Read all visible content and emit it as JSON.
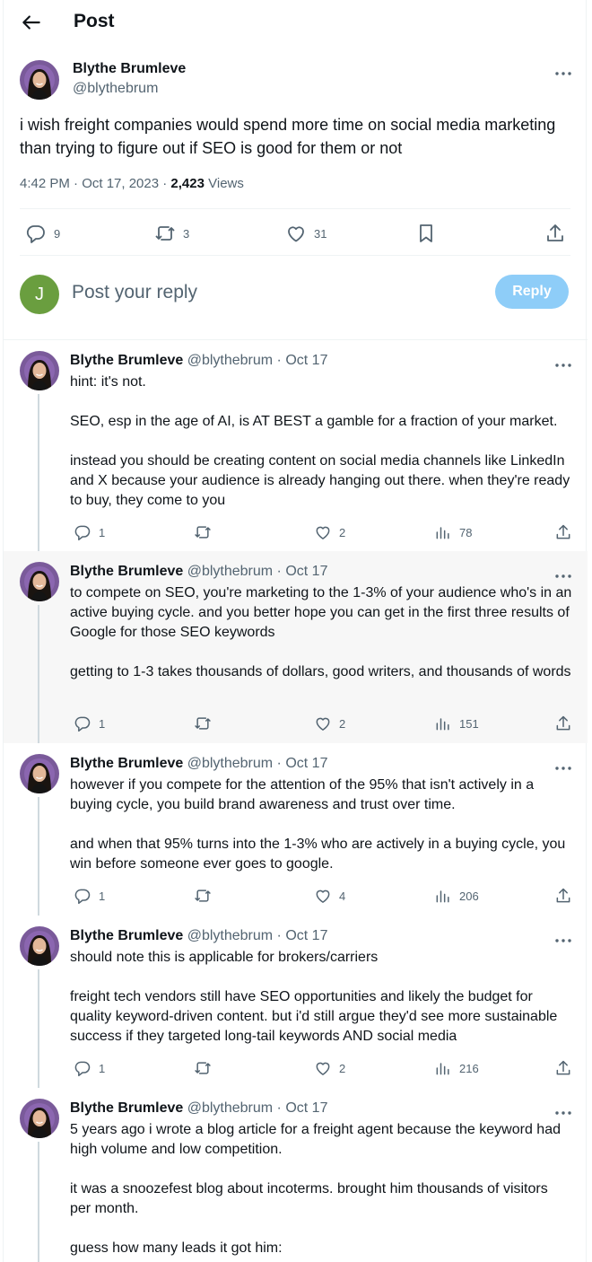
{
  "header": {
    "title": "Post"
  },
  "main_post": {
    "author": "Blythe Brumleve",
    "handle": "@blythebrum",
    "text": "i wish freight companies would spend more time on social media marketing than trying to figure out if SEO is good for them or not",
    "timestamp": "4:42 PM · Oct 17, 2023 · ",
    "views_count": "2,423",
    "views_label": " Views",
    "actions": {
      "replies": "9",
      "reposts": "3",
      "likes": "31"
    }
  },
  "reply_box": {
    "avatar_initial": "J",
    "placeholder": "Post your reply",
    "button_label": "Reply"
  },
  "replies": [
    {
      "author": "Blythe Brumleve",
      "meta": "@blythebrum · Oct 17",
      "paragraphs": [
        "hint: it's not.",
        "SEO, esp in the age of AI, is AT BEST a gamble for a fraction of your market.",
        "instead you should be creating content on social media channels like LinkedIn and X because your audience is already hanging out there. when they're ready to buy, they come to you"
      ],
      "replies": "1",
      "reposts": "",
      "likes": "2",
      "views": "78"
    },
    {
      "author": "Blythe Brumleve",
      "meta": "@blythebrum · Oct 17",
      "paragraphs": [
        "to compete on SEO, you're marketing to the 1-3% of your audience who's in an active buying cycle. and you better hope you can get in the first three results of Google for those SEO keywords",
        "getting to 1-3 takes thousands of dollars, good writers, and thousands of words"
      ],
      "replies": "1",
      "reposts": "",
      "likes": "2",
      "views": "151"
    },
    {
      "author": "Blythe Brumleve",
      "meta": "@blythebrum · Oct 17",
      "paragraphs": [
        "however if you compete for the attention of the 95% that isn't actively in a buying cycle, you build brand awareness and trust over time.",
        "and when that 95% turns into the 1-3% who are actively in a buying cycle, you win before someone ever goes to google."
      ],
      "replies": "1",
      "reposts": "",
      "likes": "4",
      "views": "206"
    },
    {
      "author": "Blythe Brumleve",
      "meta": "@blythebrum · Oct 17",
      "paragraphs": [
        "should note this is applicable for brokers/carriers",
        "freight tech vendors still have SEO opportunities and likely the budget for quality keyword-driven content. but i'd still argue they'd see more sustainable success if they targeted long-tail keywords AND social media"
      ],
      "replies": "1",
      "reposts": "",
      "likes": "2",
      "views": "216"
    },
    {
      "author": "Blythe Brumleve",
      "meta": "@blythebrum · Oct 17",
      "paragraphs": [
        "5 years ago i wrote a blog article for a freight agent because the keyword had high volume and low competition.",
        "it was a snoozefest blog about incoterms. brought him thousands of visitors per month.",
        "guess how many leads it got him:"
      ]
    }
  ],
  "colors": {
    "accent": "#1d9bf0",
    "reply_button": "#8ecdf8",
    "secondary_text": "#536471",
    "highlight_bg": "#f7f7f7"
  }
}
